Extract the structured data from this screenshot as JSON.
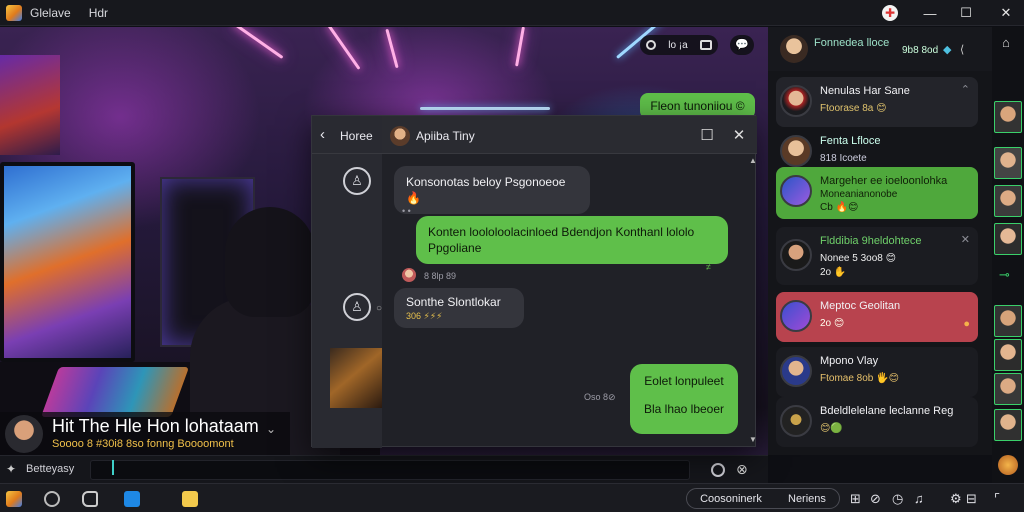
{
  "titlebar": {
    "app_name": "Glelave",
    "tab_label": "Hdr"
  },
  "stream": {
    "title": "Hit The Hle Hon lohataam",
    "subtitle": "Soooo  8 #30i8  8so fonng Boooomont",
    "input_label": "Betteyasy"
  },
  "top_controls": {
    "status": "lo ¡a"
  },
  "chat": {
    "back_label": "Horee",
    "contact_name": "Apiiba Tiny",
    "messages": [
      {
        "dir": "in",
        "text": "Konsonotas beloy Psgonoeoe 🔥"
      },
      {
        "dir": "out",
        "text": "Konten loololoolacinloed Bdendjon Konthanl lololo Ppgoliane",
        "time": "≠"
      },
      {
        "dir": "in_meta",
        "text": "8 8lp 89"
      },
      {
        "dir": "in",
        "text": "Sonthe Slontlokar",
        "sub": "306 ⚡⚡⚡"
      },
      {
        "dir": "out",
        "text": "Eolet lonpuleet\n\nBla lhao lbeoer",
        "time": "Oso 8⊘"
      }
    ],
    "top_bubble": "Fleon tunoniiou ©"
  },
  "right_panel": {
    "header_name": "Fonnedea lloce",
    "header_time": "9b8 8od",
    "items": [
      {
        "name": "Nenulas Har Sane",
        "sub": "Ftoorase 8a 😊",
        "style": "normal"
      },
      {
        "name": "Fenta Lfloce",
        "sub": "818 Icoete",
        "style": "plain"
      },
      {
        "name": "Margeher ee ioeloonlohka",
        "sub": "Moneanianonobe",
        "sub2": "Cb 🔥😊",
        "style": "green"
      },
      {
        "name": "Flddibia 9heldohtece",
        "sub": "Nonee 5 3oo8 😊",
        "sub2": "2o ✋",
        "style": "dark"
      },
      {
        "name": "Meptoc Geolitan",
        "sub": "2o 😊",
        "style": "red"
      },
      {
        "name": "Mpono Vlay",
        "sub": "Ftomae 8ob 🖐😊",
        "style": "normal"
      },
      {
        "name": "Bdeldlelelane leclanne Reg",
        "sub": "😊🟢",
        "style": "normal"
      }
    ]
  },
  "taskbar": {
    "pill_left": "Coosoninerk",
    "pill_right": "Neriens"
  },
  "colors": {
    "accent_green": "#5fbf4a",
    "accent_red": "#b8434e",
    "accent_gold": "#f0c04a"
  }
}
